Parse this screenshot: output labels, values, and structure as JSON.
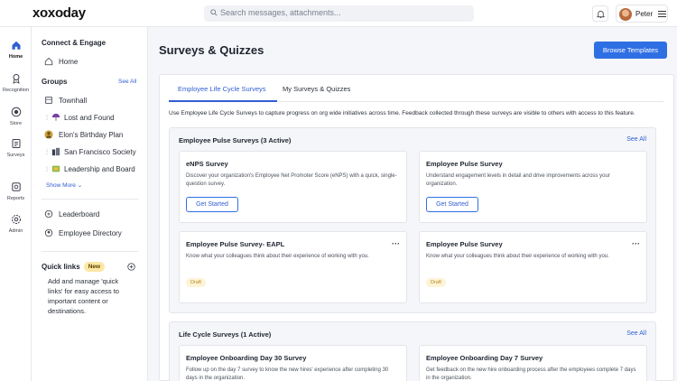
{
  "header": {
    "logo": "xoxoday",
    "search_placeholder": "Search messages, attachments...",
    "user_name": "Peter"
  },
  "rail": {
    "items": [
      {
        "label": "Home",
        "icon": "home-icon",
        "active": true
      },
      {
        "label": "Recognition",
        "icon": "award-icon"
      },
      {
        "label": "Store",
        "icon": "store-icon"
      },
      {
        "label": "Surveys",
        "icon": "survey-icon"
      },
      {
        "label": "Reports",
        "icon": "reports-icon"
      },
      {
        "label": "Admin",
        "icon": "admin-icon"
      }
    ]
  },
  "sidebar": {
    "section_title": "Connect & Engage",
    "home_label": "Home",
    "groups_title": "Groups",
    "groups_see_all": "See All",
    "groups": [
      {
        "label": "Townhall",
        "icon": "townhall-icon"
      },
      {
        "label": "Lost and Found",
        "icon": "umbrella-icon"
      },
      {
        "label": "Elon's Birthday Plan",
        "icon": "person-icon"
      },
      {
        "label": "San Francisco Society",
        "icon": "city-icon"
      },
      {
        "label": "Leadership and Board",
        "icon": "board-icon"
      }
    ],
    "show_more": "Show More",
    "leaderboard": "Leaderboard",
    "directory": "Employee Directory",
    "quick_links_title": "Quick links",
    "quick_links_badge": "New",
    "quick_links_text": "Add and manage 'quick links' for easy access to important content or destinations."
  },
  "main": {
    "title": "Surveys & Quizzes",
    "browse_button": "Browse Templates",
    "tabs": [
      "Employee Life Cycle Surveys",
      "My Surveys & Quizzes"
    ],
    "description": "Use Employee Life Cycle Surveys to capture progress on org wide initiatives across time. Feedback collected through these surveys are visible to others with access to this feature.",
    "pulse_group": {
      "title": "Employee Pulse Surveys (3 Active)",
      "see_all": "See All",
      "cards": [
        {
          "title": "eNPS Survey",
          "desc": "Discover your organization's Employee Net Promoter Score (eNPS) with a quick, single-question survey.",
          "button": "Get Started"
        },
        {
          "title": "Employee Pulse Survey",
          "desc": "Understand engagement levels in detail and drive improvements across your organization.",
          "button": "Get Started"
        },
        {
          "title": "Employee Pulse Survey- EAPL",
          "desc": "Know what your colleagues think about their experience of working with you.",
          "status": "Draft"
        },
        {
          "title": "Employee Pulse Survey",
          "desc": "Know what your colleagues think about their experience of working with you.",
          "status": "Draft"
        }
      ]
    },
    "lifecycle_group": {
      "title": "Life Cycle Surveys (1 Active)",
      "see_all": "See All",
      "cards": [
        {
          "title": "Employee Onboarding Day 30 Survey",
          "desc": "Follow up on the day 7 survey to know the new hires' experience after completing 30 days in the organization."
        },
        {
          "title": "Employee Onboarding Day 7 Survey",
          "desc": "Get feedback on the new hire onboarding process after the employees complete 7 days in the organization."
        }
      ]
    }
  },
  "colors": {
    "accent": "#2f6fe4",
    "link": "#2f5fd0",
    "draft_bg": "#fdf3d6"
  }
}
